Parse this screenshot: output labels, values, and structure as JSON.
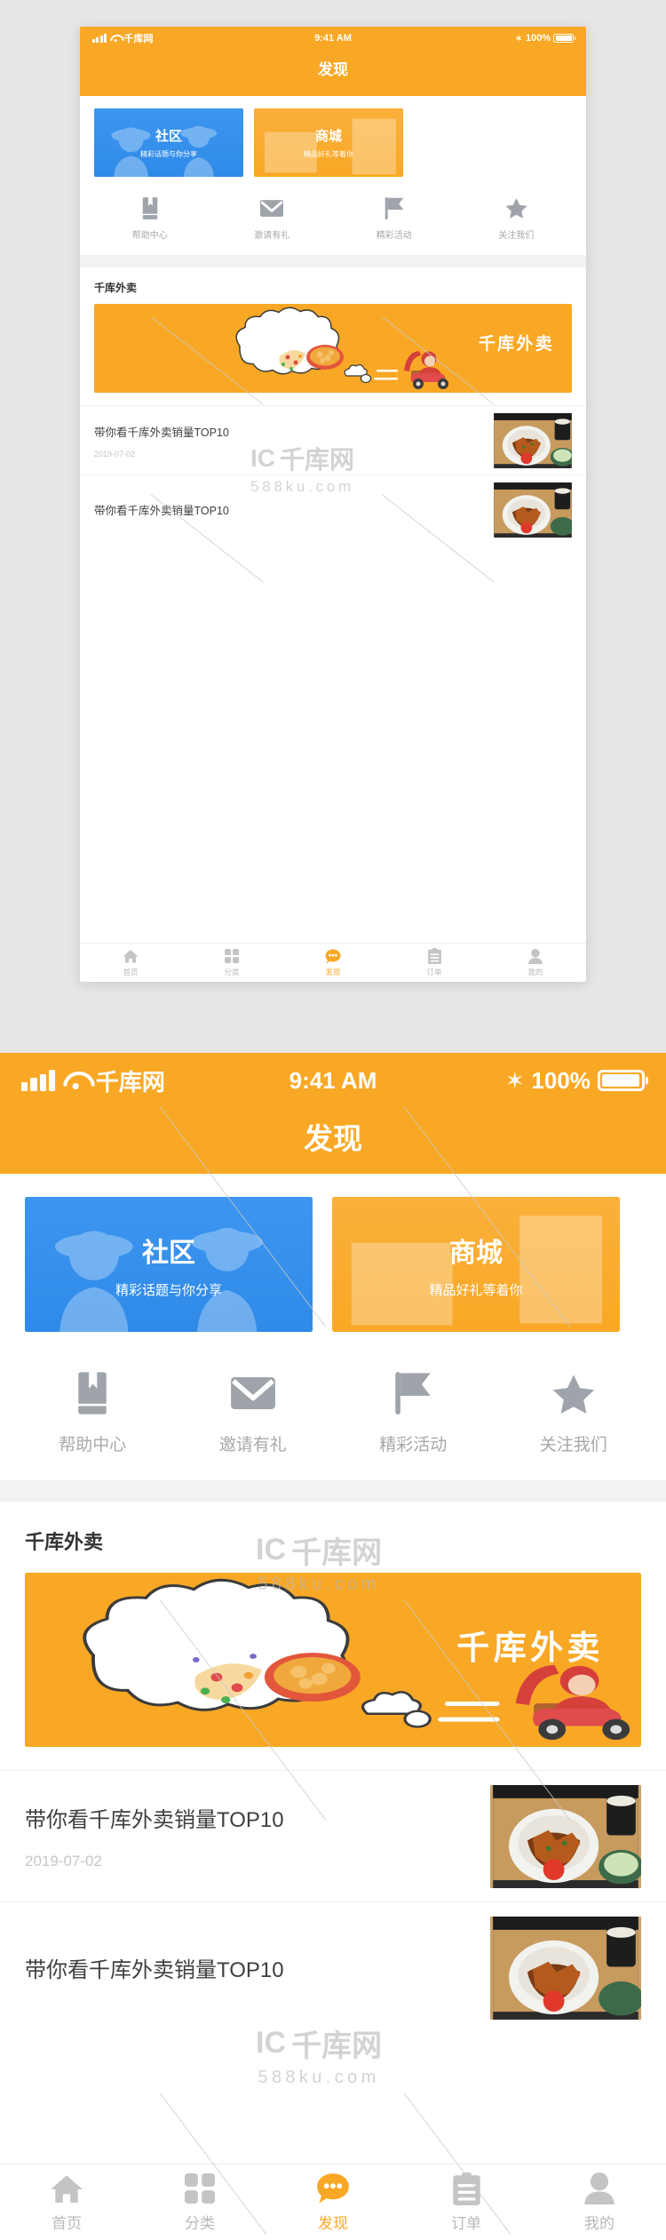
{
  "theme": {
    "brand_orange": "#F9A825",
    "community_blue": "#3D96F0",
    "mall_orange": "#FBB03B",
    "muted_gray": "#B9B9B9",
    "page_bg": "#E6E6E6"
  },
  "status_bar": {
    "carrier": "千库网",
    "time": "9:41 AM",
    "battery_percent": "100%",
    "signal_icon": "signal-bars-icon",
    "wifi_icon": "wifi-icon",
    "bluetooth_icon": "bluetooth-icon",
    "bluetooth_glyph": "✶",
    "battery_icon": "battery-full-icon"
  },
  "nav": {
    "title": "发现"
  },
  "entry_cards": [
    {
      "title": "社区",
      "subtitle": "精彩话题与你分享",
      "color": "#3D96F0",
      "icon": "people-silhouette-icon"
    },
    {
      "title": "商城",
      "subtitle": "精品好礼等着你",
      "color": "#FBB03B",
      "icon": "shop-awning-icon"
    }
  ],
  "quick_links": [
    {
      "label": "帮助中心",
      "icon": "book-icon"
    },
    {
      "label": "邀请有礼",
      "icon": "envelope-icon"
    },
    {
      "label": "精彩活动",
      "icon": "flag-icon"
    },
    {
      "label": "关注我们",
      "icon": "star-icon"
    }
  ],
  "section": {
    "title": "千库外卖"
  },
  "banner": {
    "text": "千库外卖",
    "bg_color": "#F9A825",
    "icon": "takeaway-scooter-illustration"
  },
  "articles": [
    {
      "title": "带你看千库外卖销量TOP10",
      "date": "2019-07-02",
      "thumb": "eel-rice-bowl-photo"
    },
    {
      "title": "带你看千库外卖销量TOP10",
      "date": "",
      "thumb": "eel-rice-bowl-photo"
    }
  ],
  "tabbar": [
    {
      "label": "首页",
      "icon": "home-icon",
      "active": false
    },
    {
      "label": "分类",
      "icon": "grid-icon",
      "active": false
    },
    {
      "label": "发现",
      "icon": "chat-bubble-icon",
      "active": true
    },
    {
      "label": "订单",
      "icon": "clipboard-icon",
      "active": false
    },
    {
      "label": "我的",
      "icon": "person-icon",
      "active": false
    }
  ],
  "watermark": {
    "mark": "千库网",
    "site": "588ku.com",
    "logo": "ic-logo-icon"
  }
}
